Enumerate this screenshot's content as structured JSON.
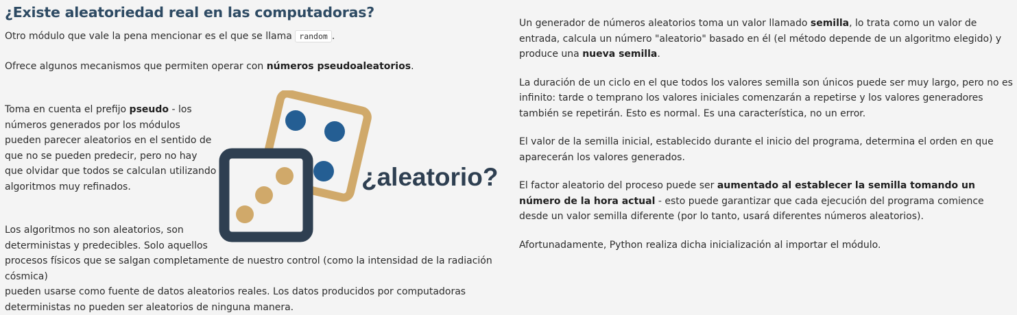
{
  "left": {
    "title": "¿Existe aleatoriedad real en las computadoras?",
    "p1_text": "Otro módulo que vale la pena mencionar es el que se llama ",
    "p1_code": "random",
    "p1_end": ".",
    "p2_text": "Ofrece algunos mecanismos que permiten operar con ",
    "p2_bold": "números pseudoaleatorios",
    "p2_end": ".",
    "p3_line1_text": "Toma en cuenta el prefijo ",
    "p3_line1_bold": "pseudo",
    "p3_line1_end": " - los",
    "p3_line2": "números generados por los módulos",
    "p3_line3": "pueden parecer aleatorios en el sentido de",
    "p3_line4": "que no se pueden predecir, pero no hay",
    "p3_line5": "que olvidar que todos se calculan utilizando",
    "p3_line6": "algoritmos muy refinados.",
    "p4_line1": "Los algoritmos no son aleatorios, son",
    "p4_line2": "deterministas y predecibles. Solo aquellos",
    "p4_line3": "procesos físicos que se salgan completamente de nuestro control (como la intensidad de la radiación cósmica)",
    "p4_line4": "pueden usarse como fuente de datos aleatorios reales. Los datos producidos por computadoras",
    "p4_line5": "deterministas no pueden ser aleatorios de ninguna manera.",
    "image_text": "¿aleatorio?"
  },
  "right": {
    "r1_a": "Un generador de números aleatorios toma un valor llamado ",
    "r1_b": "semilla",
    "r1_c": ", lo trata como un valor de entrada, calcula un número \"aleatorio\" basado en él (el método depende de un algoritmo elegido) y produce una ",
    "r1_d": "nueva semilla",
    "r1_e": ".",
    "r2": "La duración de un ciclo en el que todos los valores semilla son únicos puede ser muy largo, pero no es infinito: tarde o temprano los valores iniciales comenzarán a repetirse y los valores generadores también se repetirán. Esto es normal. Es una característica, no un error.",
    "r3": "El valor de la semilla inicial, establecido durante el inicio del programa, determina el orden en que aparecerán los valores generados.",
    "r4_a": "El factor aleatorio del proceso puede ser ",
    "r4_b": "aumentado al establecer la semilla tomando un número de la hora actual",
    "r4_c": " - esto puede garantizar que cada ejecución del programa comience desde un valor semilla diferente (por lo tanto, usará diferentes números aleatorios).",
    "r5": "Afortunadamente, Python realiza dicha inicialización al importar el módulo."
  },
  "colors": {
    "title": "#2d4a63",
    "dark_die": "#2e3f51",
    "gold_die": "#d0a96a",
    "blue_pip": "#245e93"
  }
}
